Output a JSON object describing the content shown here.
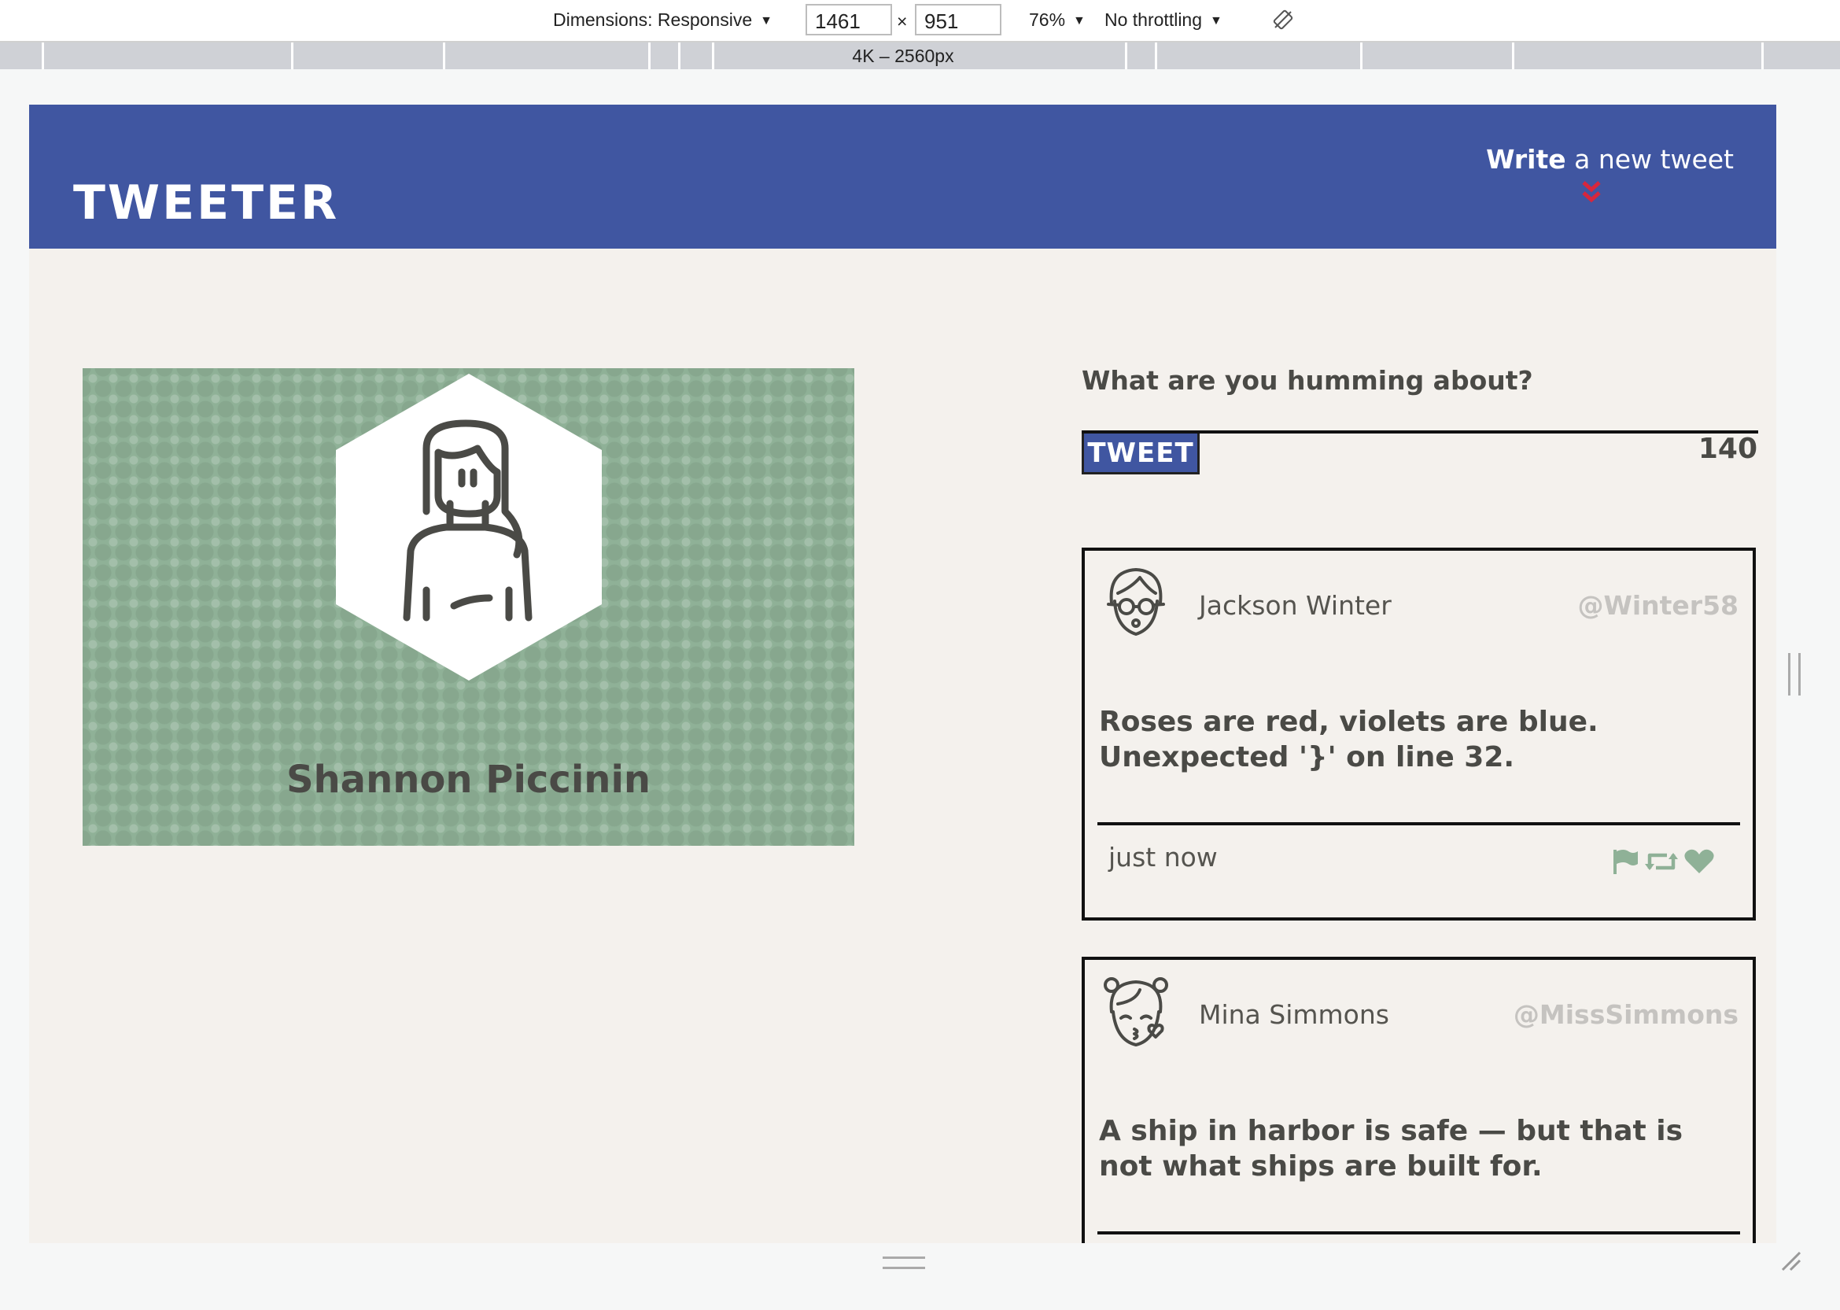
{
  "devtools": {
    "dimensions_label": "Dimensions: Responsive",
    "width_value": "1461",
    "times": "×",
    "height_value": "951",
    "zoom": "76%",
    "throttling": "No throttling",
    "ruler_label": "4K – 2560px"
  },
  "nav": {
    "logo": "TWEETER",
    "write_bold": "Write",
    "write_rest": " a new tweet"
  },
  "profile": {
    "name": "Shannon Piccinin"
  },
  "compose": {
    "label": "What are you humming about?",
    "button": "TWEET",
    "counter": "140"
  },
  "tweets": [
    {
      "author": "Jackson Winter",
      "handle": "@Winter58",
      "content": "Roses are red, violets are blue. Unexpected '}' on line 32.",
      "time": "just now"
    },
    {
      "author": "Mina Simmons",
      "handle": "@MissSimmons",
      "content": "A ship in harbor is safe — but that is not what ships are built for."
    }
  ],
  "colors": {
    "nav": "#4056a1",
    "page_bg": "#f4f1ed",
    "profile_bg": "#8fb197",
    "accent_arrow": "#d7263d",
    "action_icons": "#8fb197"
  },
  "icons": [
    "rotate-icon",
    "chevron-down-icon",
    "user-avatar-icon",
    "flag-icon",
    "retweet-icon",
    "heart-icon"
  ]
}
